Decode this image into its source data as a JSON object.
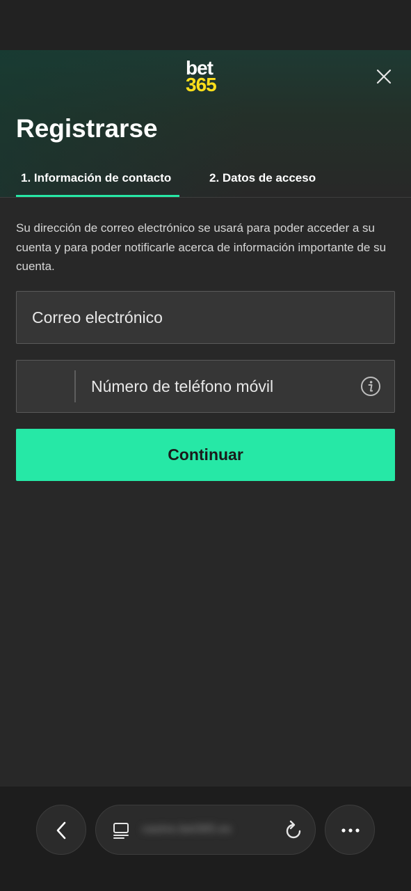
{
  "logo": {
    "line1": "bet",
    "line2": "365"
  },
  "page": {
    "title": "Registrarse"
  },
  "tabs": [
    {
      "label": "1.  Información de contacto",
      "active": true
    },
    {
      "label": "2.  Datos de acceso",
      "active": false
    }
  ],
  "intro_text": "Su dirección de correo electrónico se usará para poder acceder a su cuenta y para poder notificarle acerca de información importante de su cuenta.",
  "form": {
    "email_placeholder": "Correo electrónico",
    "email_value": "",
    "phone_placeholder": "Número de teléfono móvil",
    "phone_value": "",
    "phone_country_code": "",
    "continue_label": "Continuar"
  },
  "browser": {
    "url": "casino.bet365.es"
  },
  "colors": {
    "accent": "#26e8a6",
    "logo_yellow": "#ffdf1b",
    "background": "#282828"
  },
  "icons": [
    "close-icon",
    "info-icon",
    "back-icon",
    "tabs-icon",
    "reload-icon",
    "more-icon"
  ]
}
